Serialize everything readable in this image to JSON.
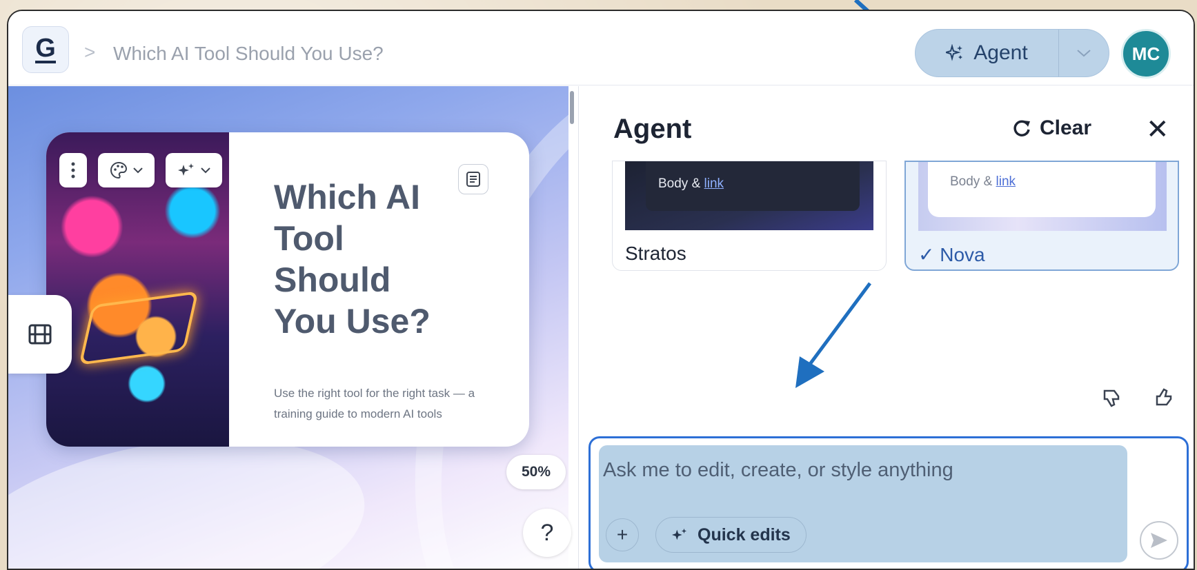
{
  "header": {
    "logo_letter": "G",
    "breadcrumb_separator": ">",
    "doc_title": "Which AI Tool Should You Use?",
    "agent_button_label": "Agent",
    "avatar_initials": "MC"
  },
  "canvas": {
    "slide_title": "Which AI Tool Should You Use?",
    "slide_subtitle": "Use the right tool for the right task — a training guide to modern AI tools",
    "zoom_level": "50%",
    "help_label": "?"
  },
  "agent_panel": {
    "title": "Agent",
    "clear_label": "Clear",
    "close_label": "✕",
    "themes": [
      {
        "name": "Stratos",
        "preview_body": "Body & ",
        "preview_link": "link",
        "selected": false
      },
      {
        "name": "Nova",
        "preview_body": "Body & ",
        "preview_link": "link",
        "selected": true,
        "check": "✓"
      }
    ],
    "input": {
      "placeholder": "Ask me to edit, create, or style anything",
      "plus_label": "+",
      "quick_edits_label": "Quick edits"
    }
  },
  "colors": {
    "accent_blue": "#2d6fd6",
    "avatar_teal": "#1e8a97",
    "agent_button_bg": "#bcd3e8",
    "annotation_arrow": "#1f6fbf"
  },
  "icons": {
    "agent": "sparkle-icon",
    "clear": "refresh-icon",
    "close": "close-icon",
    "film": "film-icon",
    "notes": "notes-icon",
    "send": "send-icon",
    "thumbs_down": "thumbs-down-icon",
    "thumbs_up": "thumbs-up-icon"
  }
}
